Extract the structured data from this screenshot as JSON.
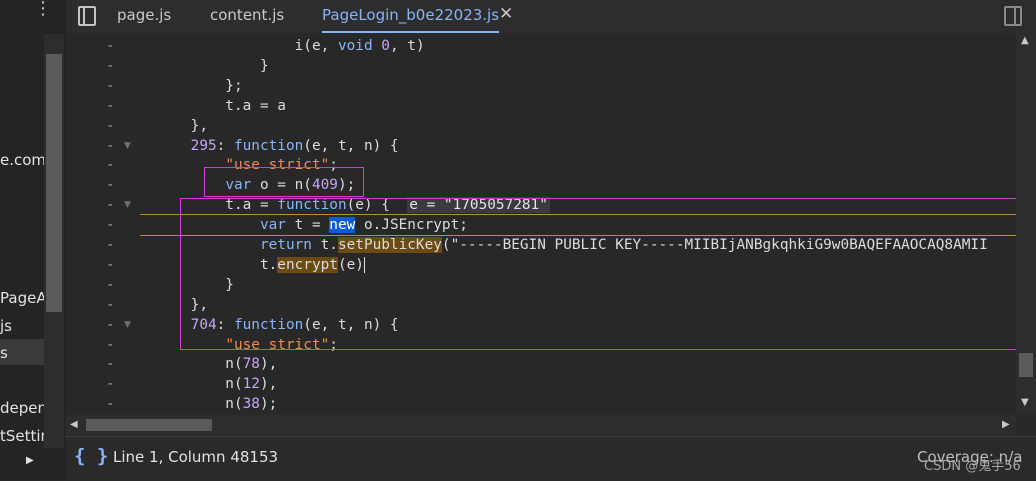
{
  "navigator": {
    "items": [
      "e.com",
      "PageA",
      "js",
      "s",
      "depen",
      "tSettin"
    ],
    "more_icon": "kebab-icon",
    "expand_icon": "triangle-right-icon"
  },
  "tabs": [
    {
      "label": "page.js"
    },
    {
      "label": "content.js"
    },
    {
      "label": "PageLogin_b0e22023.js"
    }
  ],
  "code_lines": [
    {
      "text": "                i(e, void 0, t)"
    },
    {
      "text": "            }"
    },
    {
      "text": "        };"
    },
    {
      "text": "        t.a = a"
    },
    {
      "text": "    },"
    },
    {
      "text": "    295: function(e, t, n) {"
    },
    {
      "text": "        \"use strict\";"
    },
    {
      "text": "        var o = n(409);"
    },
    {
      "text": "        t.a = function(e) {"
    },
    {
      "text": "            var t = new o.JSEncrypt;"
    },
    {
      "text": "            return t.setPublicKey(\"-----BEGIN PUBLIC KEY-----MIIBIjANBgkqhkiG9w0BAQEFAAOCAQ8AMII"
    },
    {
      "text": "            t.encrypt(e)"
    },
    {
      "text": "        }"
    },
    {
      "text": "    },"
    },
    {
      "text": "    704: function(e, t, n) {"
    },
    {
      "text": "        \"use strict\";"
    },
    {
      "text": "        n(78),"
    },
    {
      "text": "        n(12),"
    },
    {
      "text": "        n(38);"
    }
  ],
  "gutter_marker": "-",
  "inline_eval": "e = \"1705057281\"",
  "status": {
    "position": "Line 1, Column 48153",
    "coverage": "Coverage: n/a",
    "watermark": "CSDN @鬼手56"
  },
  "colors": {
    "highlight_box": "#d33ad3",
    "accent": "#8ab4f8"
  }
}
